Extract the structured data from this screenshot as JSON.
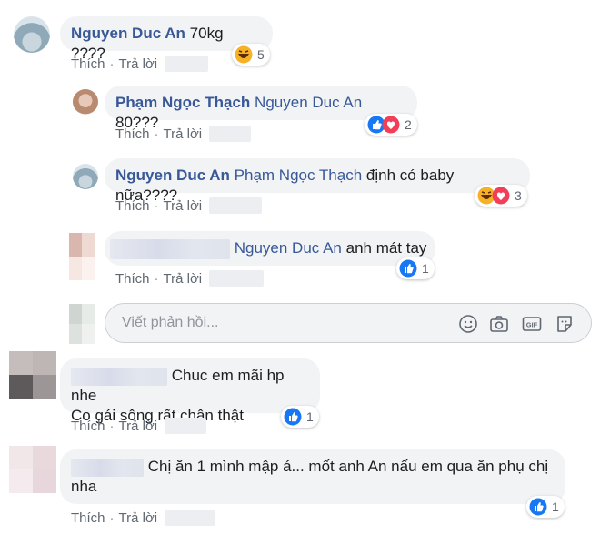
{
  "colors": {
    "author": "#385898",
    "bubble": "#f2f3f5",
    "meta": "#606770",
    "like_blue": "#1877f2",
    "love_red": "#f33e58",
    "haha_yellow": "#f7b125"
  },
  "comments": [
    {
      "author": "Nguyen Duc An",
      "mention": "",
      "text": "70kg ????",
      "like_label": "Thích",
      "reply_label": "Trả lời",
      "reactions": [
        "haha-icon"
      ],
      "reaction_count": "5"
    },
    {
      "author": "Phạm Ngọc Thạch",
      "mention": "Nguyen Duc An",
      "text": "80???",
      "like_label": "Thích",
      "reply_label": "Trả lời",
      "reactions": [
        "like-icon",
        "love-icon"
      ],
      "reaction_count": "2"
    },
    {
      "author": "Nguyen Duc An",
      "mention": "Phạm Ngọc Thạch",
      "text": "định có baby nữa????",
      "like_label": "Thích",
      "reply_label": "Trả lời",
      "reactions": [
        "haha-icon",
        "love-icon"
      ],
      "reaction_count": "3"
    },
    {
      "author": "",
      "mention": "Nguyen Duc An",
      "text": "anh mát tay",
      "like_label": "Thích",
      "reply_label": "Trả lời",
      "reactions": [
        "like-icon"
      ],
      "reaction_count": "1"
    },
    {
      "author": "",
      "mention": "",
      "text_line1": "Chuc em mãi hp nhe",
      "text_line2": "Co gái sông rất chân thật",
      "like_label": "Thích",
      "reply_label": "Trả lời",
      "reactions": [
        "like-icon"
      ],
      "reaction_count": "1"
    },
    {
      "author": "",
      "mention": "",
      "text_line1": "Chị ăn 1 mình mập á... mốt anh An nấu em qua ăn phụ chị",
      "text_line2": "nha",
      "like_label": "Thích",
      "reply_label": "Trả lời",
      "reactions": [
        "like-icon"
      ],
      "reaction_count": "1"
    }
  ],
  "reply_input": {
    "placeholder": "Viết phản hồi...",
    "tools": [
      "smiley-icon",
      "camera-icon",
      "gif-icon",
      "sticker-icon"
    ]
  }
}
